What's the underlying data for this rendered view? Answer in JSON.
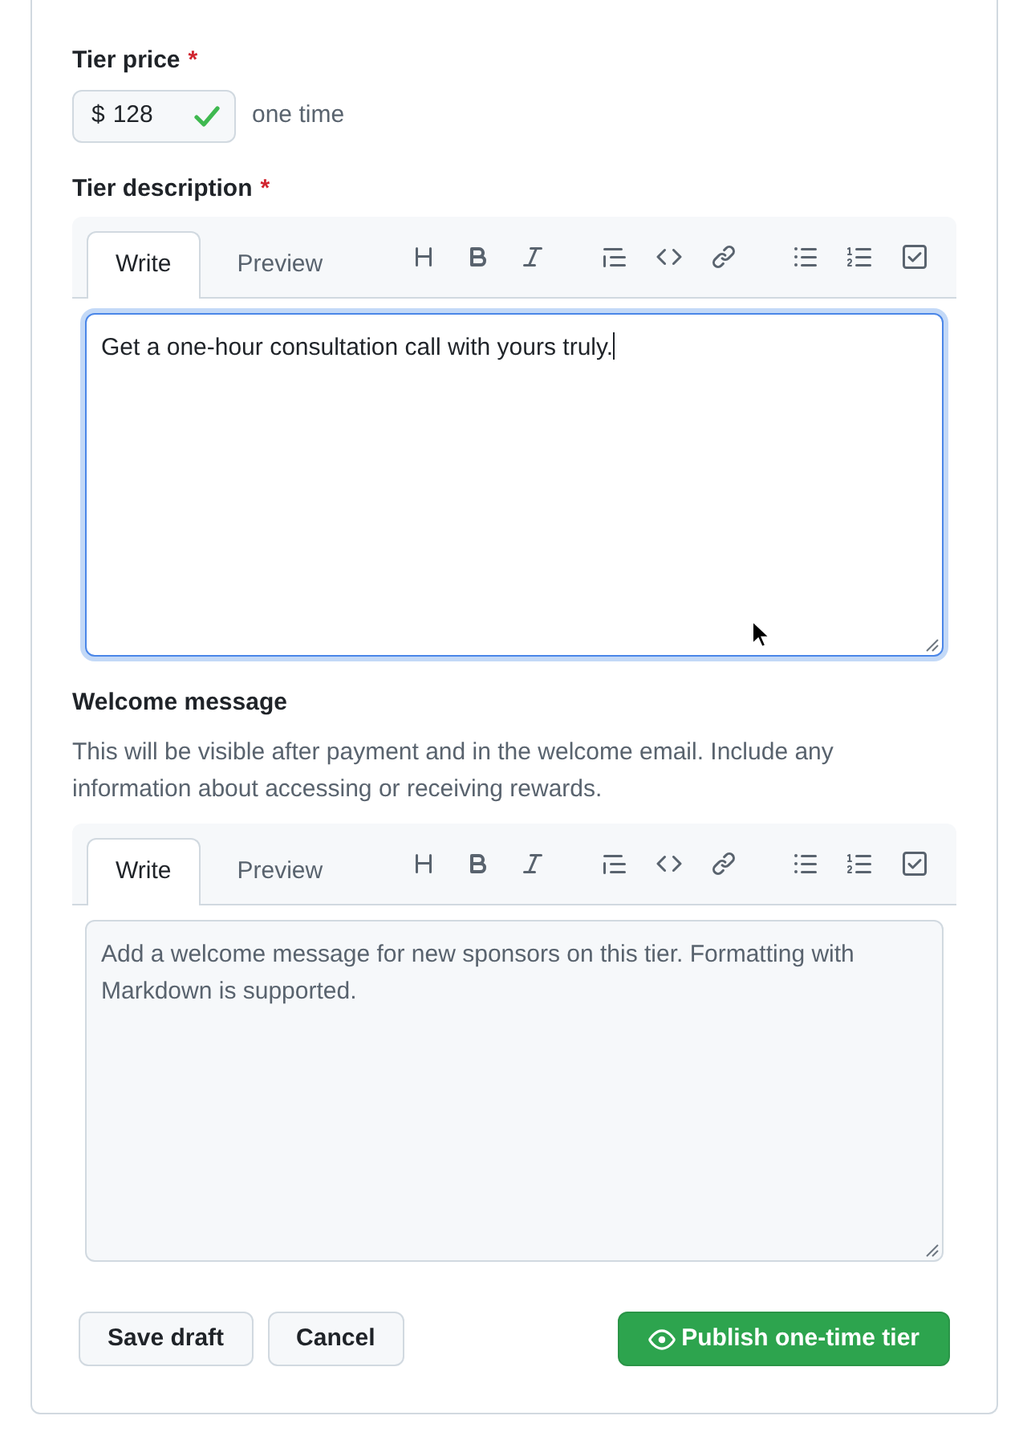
{
  "price": {
    "label": "Tier price",
    "required_mark": "*",
    "currency": "$",
    "value": "128",
    "valid": true,
    "suffix": "one time"
  },
  "editors": [
    {
      "label": "Tier description",
      "required_mark": "*",
      "tabs": [
        {
          "label": "Write",
          "selected": true
        },
        {
          "label": "Preview",
          "selected": false
        }
      ],
      "value": "Get a one-hour consultation call with yours truly.",
      "focused": true
    },
    {
      "label": "Welcome message",
      "description": "This will be visible after payment and in the welcome email. Include any information about accessing or receiving rewards.",
      "tabs": [
        {
          "label": "Write",
          "selected": true
        },
        {
          "label": "Preview",
          "selected": false
        }
      ],
      "placeholder": "Add a welcome message for new sponsors on this tier. Formatting with Markdown is supported.",
      "focused": false
    }
  ],
  "buttons": [
    {
      "label": "Save draft",
      "kind": "secondary"
    },
    {
      "label": "Cancel",
      "kind": "secondary"
    },
    {
      "label": "Publish one-time tier",
      "kind": "primary"
    }
  ]
}
